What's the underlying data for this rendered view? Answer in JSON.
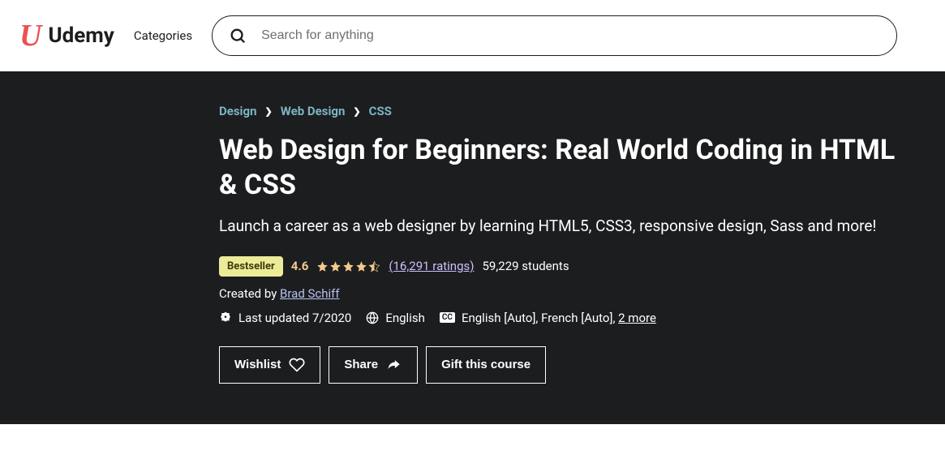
{
  "header": {
    "brand": "Udemy",
    "categories": "Categories",
    "search_placeholder": "Search for anything"
  },
  "breadcrumb": [
    "Design",
    "Web Design",
    "CSS"
  ],
  "course": {
    "title": "Web Design for Beginners: Real World Coding in HTML & CSS",
    "subtitle": "Launch a career as a web designer by learning HTML5, CSS3, responsive design, Sass and more!",
    "badge": "Bestseller",
    "rating": "4.6",
    "ratings_count": "(16,291 ratings)",
    "students": "59,229 students",
    "created_by_label": "Created by ",
    "author": "Brad Schiff",
    "last_updated": "Last updated 7/2020",
    "language": "English",
    "captions": "English [Auto], French [Auto], ",
    "captions_more": "2 more"
  },
  "actions": {
    "wishlist": "Wishlist",
    "share": "Share",
    "gift": "Gift this course"
  }
}
